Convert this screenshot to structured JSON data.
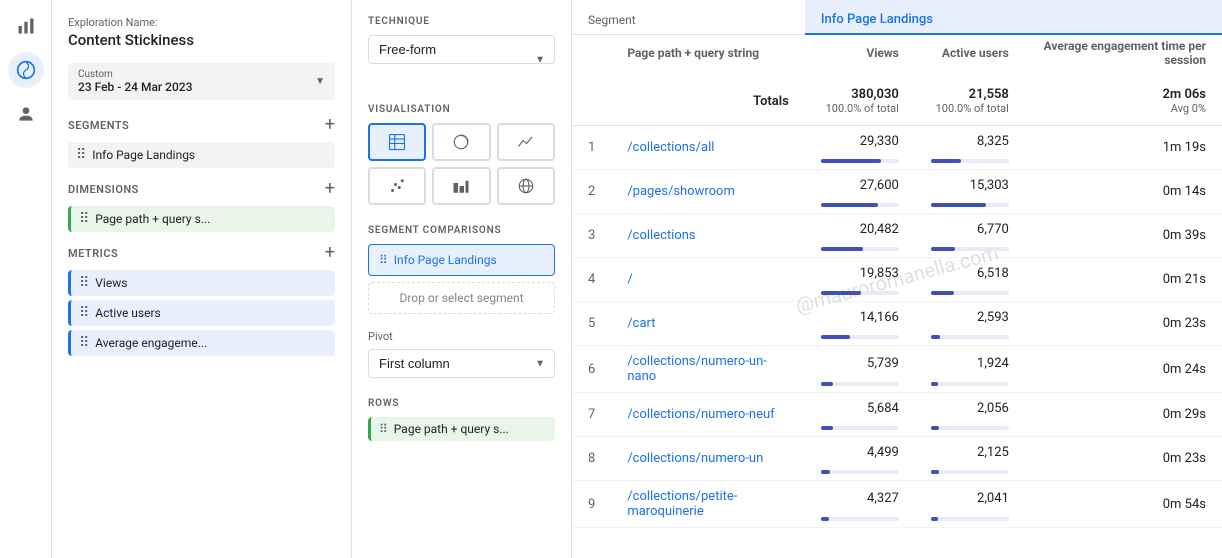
{
  "app": {
    "title": "Content Stickiness",
    "exploration_label": "Exploration Name:"
  },
  "nav": {
    "icons": [
      {
        "name": "bar-chart-icon",
        "symbol": "📊",
        "active": true
      },
      {
        "name": "analytics-icon",
        "symbol": "🔵",
        "active": false
      },
      {
        "name": "person-icon",
        "symbol": "👤",
        "active": false
      }
    ]
  },
  "panel": {
    "date": {
      "label": "Custom",
      "range": "23 Feb - 24 Mar 2023"
    },
    "segments_title": "SEGMENTS",
    "segment": "Info Page Landings",
    "dimensions_title": "DIMENSIONS",
    "dimension": "Page path + query s...",
    "metrics_title": "METRICS",
    "metrics": [
      "Views",
      "Active users",
      "Average engageme..."
    ]
  },
  "config": {
    "technique_label": "TECHNIQUE",
    "technique_value": "Free-form",
    "visualisation_label": "VISUALISATION",
    "viz_buttons": [
      {
        "icon": "⊞",
        "label": "table",
        "active": true
      },
      {
        "icon": "◑",
        "label": "donut",
        "active": false
      },
      {
        "icon": "〰",
        "label": "line",
        "active": false
      },
      {
        "icon": "⚬",
        "label": "scatter",
        "active": false
      },
      {
        "icon": "≡",
        "label": "bars",
        "active": false
      },
      {
        "icon": "🌐",
        "label": "geo",
        "active": false
      }
    ],
    "segment_comparisons_label": "SEGMENT COMPARISONS",
    "segment_comparison_value": "Info Page Landings",
    "drop_segment_label": "Drop or select segment",
    "pivot_label": "Pivot",
    "pivot_value": "First column",
    "rows_label": "ROWS",
    "rows_value": "Page path + query s..."
  },
  "table": {
    "segment_col_label": "Segment",
    "dimension_col_label": "Page path + query string",
    "info_page_landings_label": "Info Page Landings",
    "col_headers": [
      "Views",
      "Active users",
      "Average engagement time per session"
    ],
    "totals_label": "Totals",
    "totals": {
      "views": "380,030",
      "views_pct": "100.0% of total",
      "active_users": "21,558",
      "active_users_pct": "100.0% of total",
      "avg_time": "2m 06s",
      "avg_time_pct": "Avg 0%"
    },
    "rows": [
      {
        "num": 1,
        "path": "/collections/all",
        "views": "29,330",
        "views_pct": 77,
        "active_users": "8,325",
        "active_users_pct": 39,
        "avg_time": "1m 19s"
      },
      {
        "num": 2,
        "path": "/pages/showroom",
        "views": "27,600",
        "views_pct": 73,
        "active_users": "15,303",
        "active_users_pct": 71,
        "avg_time": "0m 14s"
      },
      {
        "num": 3,
        "path": "/collections",
        "views": "20,482",
        "views_pct": 54,
        "active_users": "6,770",
        "active_users_pct": 31,
        "avg_time": "0m 39s"
      },
      {
        "num": 4,
        "path": "/",
        "views": "19,853",
        "views_pct": 52,
        "active_users": "6,518",
        "active_users_pct": 30,
        "avg_time": "0m 21s"
      },
      {
        "num": 5,
        "path": "/cart",
        "views": "14,166",
        "views_pct": 37,
        "active_users": "2,593",
        "active_users_pct": 12,
        "avg_time": "0m 23s"
      },
      {
        "num": 6,
        "path": "/collections/numero-un-nano",
        "views": "5,739",
        "views_pct": 15,
        "active_users": "1,924",
        "active_users_pct": 9,
        "avg_time": "0m 24s"
      },
      {
        "num": 7,
        "path": "/collections/numero-neuf",
        "views": "5,684",
        "views_pct": 15,
        "active_users": "2,056",
        "active_users_pct": 10,
        "avg_time": "0m 29s"
      },
      {
        "num": 8,
        "path": "/collections/numero-un",
        "views": "4,499",
        "views_pct": 12,
        "active_users": "2,125",
        "active_users_pct": 10,
        "avg_time": "0m 23s"
      },
      {
        "num": 9,
        "path": "/collections/petite-maroquinerie",
        "views": "4,327",
        "views_pct": 11,
        "active_users": "2,041",
        "active_users_pct": 9,
        "avg_time": "0m 54s"
      }
    ]
  }
}
